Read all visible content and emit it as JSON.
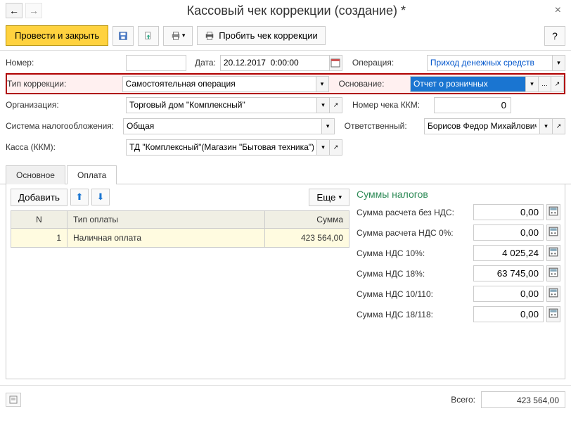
{
  "title": "Кассовый чек коррекции (создание) *",
  "toolbar": {
    "submit_close": "Провести и закрыть",
    "print_correction": "Пробить чек коррекции",
    "help": "?"
  },
  "fields": {
    "number_label": "Номер:",
    "number_value": "",
    "date_label": "Дата:",
    "date_value": "20.12.2017  0:00:00",
    "operation_label": "Операция:",
    "operation_value": "Приход денежных средств",
    "correction_type_label": "Тип коррекции:",
    "correction_type_value": "Самостоятельная операция",
    "basis_label": "Основание:",
    "basis_value": "Отчет о розничных",
    "org_label": "Организация:",
    "org_value": "Торговый дом \"Комплексный\"",
    "kkm_check_label": "Номер чека ККМ:",
    "kkm_check_value": "0",
    "tax_system_label": "Система налогообложения:",
    "tax_system_value": "Общая",
    "responsible_label": "Ответственный:",
    "responsible_value": "Борисов Федор Михайлович",
    "kassa_label": "Касса (ККМ):",
    "kassa_value": "ТД \"Комплексный\"(Магазин \"Бытовая техника\")"
  },
  "tabs": {
    "main": "Основное",
    "payment": "Оплата"
  },
  "table": {
    "add_btn": "Добавить",
    "more_btn": "Еще",
    "headers": {
      "n": "N",
      "type": "Тип оплаты",
      "sum": "Сумма"
    },
    "rows": [
      {
        "n": "1",
        "type": "Наличная оплата",
        "sum": "423 564,00"
      }
    ]
  },
  "taxes": {
    "title": "Суммы налогов",
    "rows": [
      {
        "label": "Сумма расчета без НДС:",
        "value": "0,00"
      },
      {
        "label": "Сумма расчета НДС 0%:",
        "value": "0,00"
      },
      {
        "label": "Сумма НДС 10%:",
        "value": "4 025,24"
      },
      {
        "label": "Сумма НДС 18%:",
        "value": "63 745,00"
      },
      {
        "label": "Сумма НДС 10/110:",
        "value": "0,00"
      },
      {
        "label": "Сумма НДС 18/118:",
        "value": "0,00"
      }
    ]
  },
  "footer": {
    "total_label": "Всего:",
    "total_value": "423 564,00"
  }
}
